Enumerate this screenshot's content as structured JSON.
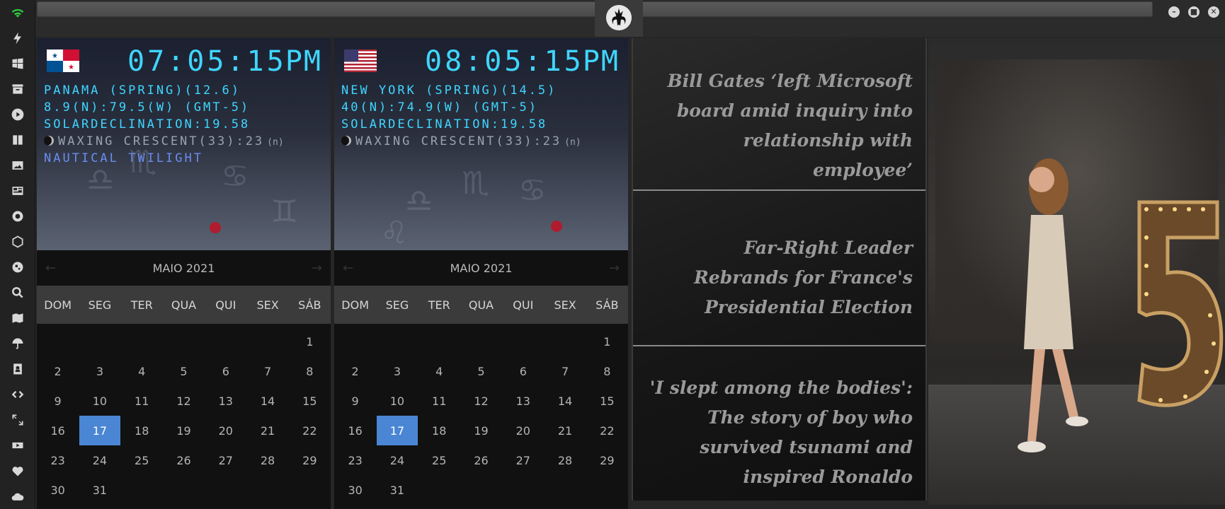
{
  "colors": {
    "clock_cyan": "#3fd6ff",
    "twilight_blue": "#6a8df0",
    "today_blue": "#4a86d4"
  },
  "rail_icons": [
    "wifi-icon",
    "bolt-icon",
    "windows-icon",
    "archive-icon",
    "play-icon",
    "book-icon",
    "image-icon",
    "news-icon",
    "settings-icon",
    "atom-icon",
    "globe-icon",
    "search-icon",
    "map-icon",
    "umbrella-icon",
    "contacts-icon",
    "code-icon",
    "fullscreen-icon",
    "youtube-icon",
    "heart-icon",
    "cloud-icon"
  ],
  "clocks": [
    {
      "flag": "panama",
      "time": "07:05:15",
      "ampm": "PM",
      "line1": "PANAMA (SPRING)(12.6)",
      "line2": "8.9(N):79.5(W) (GMT-5)",
      "line3": "SOLARDECLINATION:19.58",
      "moon": "WAXING CRESCENT(33):23",
      "moon_suffix": "(n)",
      "twilight": "NAUTICAL TWILIGHT"
    },
    {
      "flag": "usa",
      "time": "08:05:15",
      "ampm": "PM",
      "line1": "NEW YORK (SPRING)(14.5)",
      "line2": "40(N):74.9(W) (GMT-5)",
      "line3": "SOLARDECLINATION:19.58",
      "moon": "WAXING CRESCENT(33):23",
      "moon_suffix": "(n)"
    }
  ],
  "calendar": {
    "month_label": "MAIO 2021",
    "weekdays": [
      "DOM",
      "SEG",
      "TER",
      "QUA",
      "QUI",
      "SEX",
      "SÁB"
    ],
    "first_weekday_index": 6,
    "days_in_month": 31,
    "today": 17
  },
  "news": [
    "Bill Gates ‘left Microsoft board amid inquiry into relationship with employee’",
    "Far-Right Leader Rebrands for France's Presidential Election",
    "'I slept among the bodies': The story of boy who survived tsunami and inspired Ronaldo"
  ]
}
